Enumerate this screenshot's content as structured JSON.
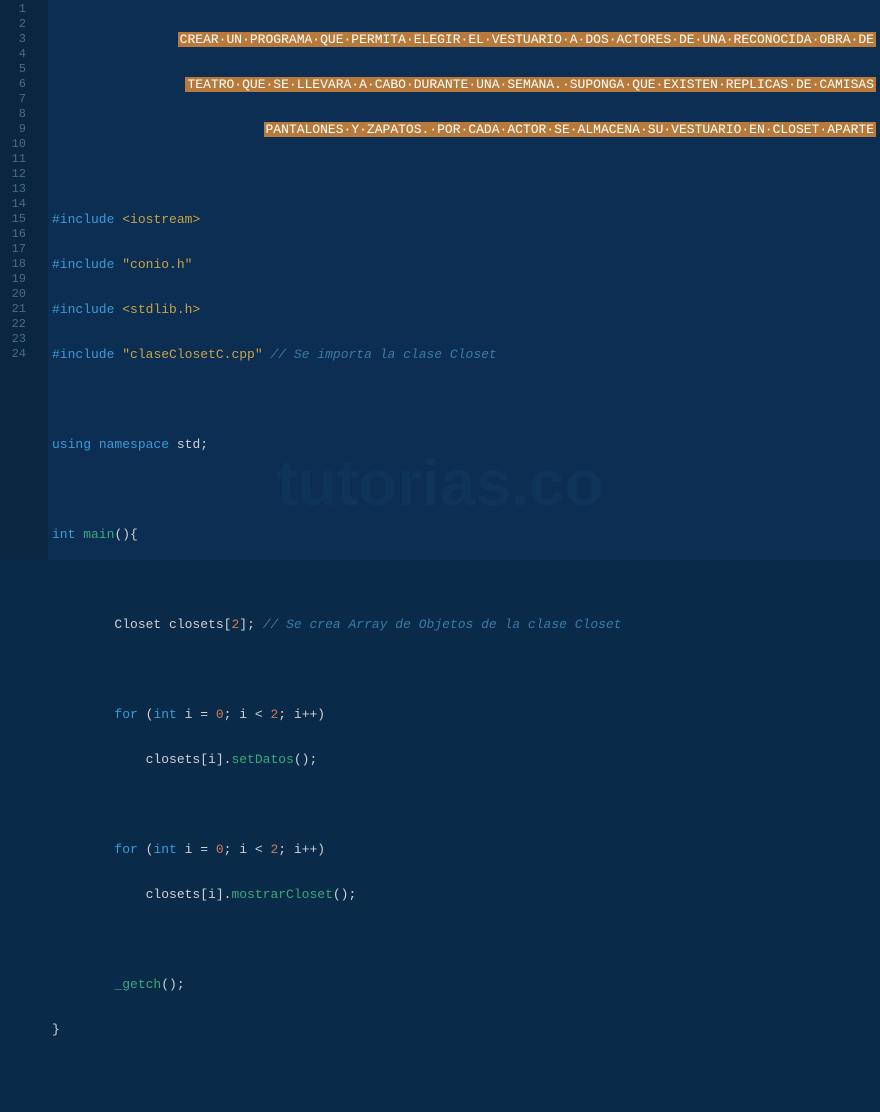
{
  "watermark": "tutorias.co",
  "line_numbers": [
    "1",
    "2",
    "3",
    "4",
    "5",
    "6",
    "7",
    "8",
    "9",
    "10",
    "11",
    "12",
    "13",
    "14",
    "15",
    "16",
    "17",
    "18",
    "19",
    "20",
    "21",
    "22",
    "23",
    "24"
  ],
  "lines": {
    "l1_comment": "CREAR·UN·PROGRAMA·QUE·PERMITA·ELEGIR·EL·VESTUARIO·A·DOS·ACTORES·DE·UNA·RECONOCIDA·OBRA·DE",
    "l2_comment": "TEATRO·QUE·SE·LLEVARA·A·CABO·DURANTE·UNA·SEMANA.·SUPONGA·QUE·EXISTEN·REPLICAS·DE·CAMISAS",
    "l3_comment": "PANTALONES·Y·ZAPATOS.·POR·CADA·ACTOR·SE·ALMACENA·SU·VESTUARIO·EN·CLOSET·APARTE",
    "l5_include": "#include",
    "l5_lib": "<iostream>",
    "l6_include": "#include",
    "l6_lib": "\"conio.h\"",
    "l7_include": "#include",
    "l7_lib": "<stdlib.h>",
    "l8_include": "#include",
    "l8_lib": "\"claseClosetC.cpp\"",
    "l8_comment": "// Se importa la clase Closet",
    "l10_using": "using",
    "l10_namespace": "namespace",
    "l10_std": "std;",
    "l12_int": "int",
    "l12_main": "main",
    "l12_paren": "(){",
    "l14_closet": "Closet closets[",
    "l14_num": "2",
    "l14_end": "];",
    "l14_comment": "// Se crea Array de Objetos de la clase Closet",
    "l16_for": "for",
    "l16_paren_open": " (",
    "l16_int": "int",
    "l16_var": " i = ",
    "l16_zero": "0",
    "l16_cond": "; i < ",
    "l16_two": "2",
    "l16_inc": "; i++)",
    "l17_arr": "closets[i].",
    "l17_method": "setDatos",
    "l17_end": "();",
    "l19_for": "for",
    "l19_paren_open": " (",
    "l19_int": "int",
    "l19_var": " i = ",
    "l19_zero": "0",
    "l19_cond": "; i < ",
    "l19_two": "2",
    "l19_inc": "; i++)",
    "l20_arr": "closets[i].",
    "l20_method": "mostrarCloset",
    "l20_end": "();",
    "l22_getch": "_getch",
    "l22_end": "();",
    "l23_close": "}"
  }
}
